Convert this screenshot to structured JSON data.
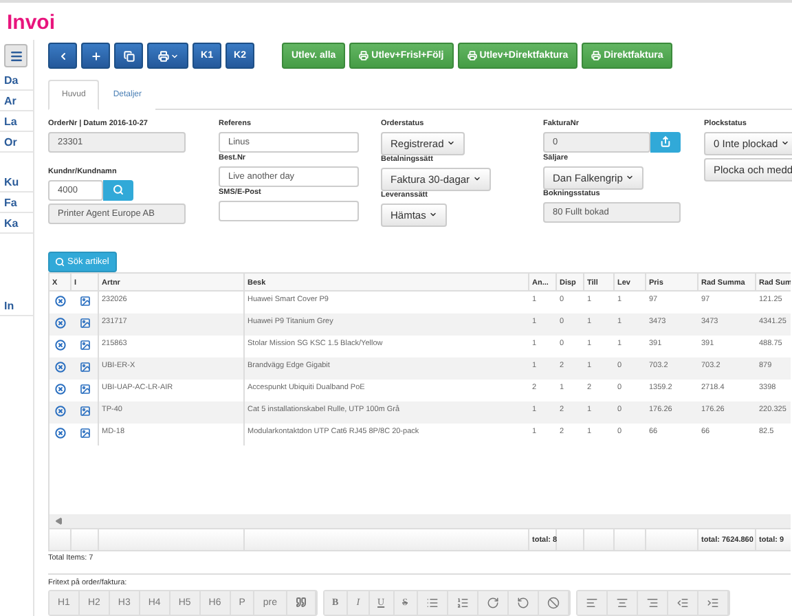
{
  "app_title": "Invoi",
  "sidebar": {
    "groups": [
      [
        "Da",
        "Ar",
        "La",
        "Or"
      ],
      [
        "Ku",
        "Fa",
        "Ka"
      ],
      [
        "In"
      ]
    ]
  },
  "toolbar": {
    "key_buttons": [
      "K1",
      "K2"
    ],
    "action_buttons": [
      {
        "label": "Utlev. alla",
        "kind": "plain"
      },
      {
        "label": "Utlev+Frisl+Följ",
        "kind": "print"
      },
      {
        "label": "Utlev+Direktfaktura",
        "kind": "print"
      },
      {
        "label": "Direktfaktura",
        "kind": "print"
      }
    ]
  },
  "tabs": [
    {
      "label": "Huvud",
      "selected": true
    },
    {
      "label": "Detaljer",
      "selected": false
    }
  ],
  "form": {
    "order_label": "OrderNr | Datum 2016-10-27",
    "order_value": "23301",
    "customer_label": "Kundnr/Kundnamn",
    "customer_number": "4000",
    "customer_name": "Printer Agent Europe AB",
    "reference_label": "Referens",
    "reference_value": "Linus",
    "order_ref_label": "Best.Nr",
    "order_ref_value": "Live another day",
    "contact_label": "SMS/E-Post",
    "order_status_label": "Orderstatus",
    "order_status": "Registrerad",
    "payment_label": "Betalningssätt",
    "payment": "Faktura 30-dagar",
    "delivery_label": "Leveranssätt",
    "delivery": "Hämtas",
    "invoice_label": "FakturaNr",
    "invoice_value": "0",
    "seller_label": "Säljare",
    "seller": "Dan Falkengrip",
    "booking_label": "Bokningsstatus",
    "booking_value": "80 Fullt bokad",
    "pick_label": "Plockstatus",
    "pick_status": "0 Inte plockad",
    "pick_button": "Plocka och medd"
  },
  "search_button": "Sök artikel",
  "table": {
    "columns": [
      "X",
      "I",
      "Artnr",
      "Besk",
      "An...",
      "Disp",
      "Till",
      "Lev",
      "Pris",
      "Rad Summa",
      "Rad Sum"
    ],
    "rows": [
      [
        "",
        "",
        "232026",
        "Huawei Smart Cover P9",
        "1",
        "0",
        "1",
        "1",
        "97",
        "97",
        "121.25"
      ],
      [
        "",
        "",
        "231717",
        "Huawei P9 Titanium Grey",
        "1",
        "0",
        "1",
        "1",
        "3473",
        "3473",
        "4341.25"
      ],
      [
        "",
        "",
        "215863",
        "Stolar Mission SG KSC 1.5 Black/Yellow",
        "1",
        "0",
        "1",
        "1",
        "391",
        "391",
        "488.75"
      ],
      [
        "",
        "",
        "UBI-ER-X",
        "Brandvägg Edge Gigabit",
        "1",
        "2",
        "1",
        "0",
        "703.2",
        "703.2",
        "879"
      ],
      [
        "",
        "",
        "UBI-UAP-AC-LR-AIR",
        "Accespunkt Ubiquiti Dualband PoE",
        "2",
        "1",
        "2",
        "0",
        "1359.2",
        "2718.4",
        "3398"
      ],
      [
        "",
        "",
        "TP-40",
        "Cat 5 installationskabel Rulle, UTP 100m Grå",
        "1",
        "2",
        "1",
        "0",
        "176.26",
        "176.26",
        "220.325"
      ],
      [
        "",
        "",
        "MD-18",
        "Modularkontaktdon UTP Cat6 RJ45 8P/8C 20-pack",
        "1",
        "2",
        "1",
        "0",
        "66",
        "66",
        "82.5"
      ]
    ],
    "totals": {
      "quantity": "total: 8",
      "row_sum": "total: 7624.860",
      "row_sum_vat": "total: 9"
    }
  },
  "total_items": "Total Items: 7",
  "note_label": "Fritext på order/faktura:",
  "editor": {
    "headings": [
      "H1",
      "H2",
      "H3",
      "H4",
      "H5",
      "H6",
      "P",
      "pre"
    ],
    "styles": [
      {
        "label": "B",
        "kind": "bold"
      },
      {
        "label": "I",
        "kind": "italic"
      },
      {
        "label": "U",
        "kind": "underline"
      },
      {
        "label": "S",
        "kind": "strike"
      }
    ]
  }
}
